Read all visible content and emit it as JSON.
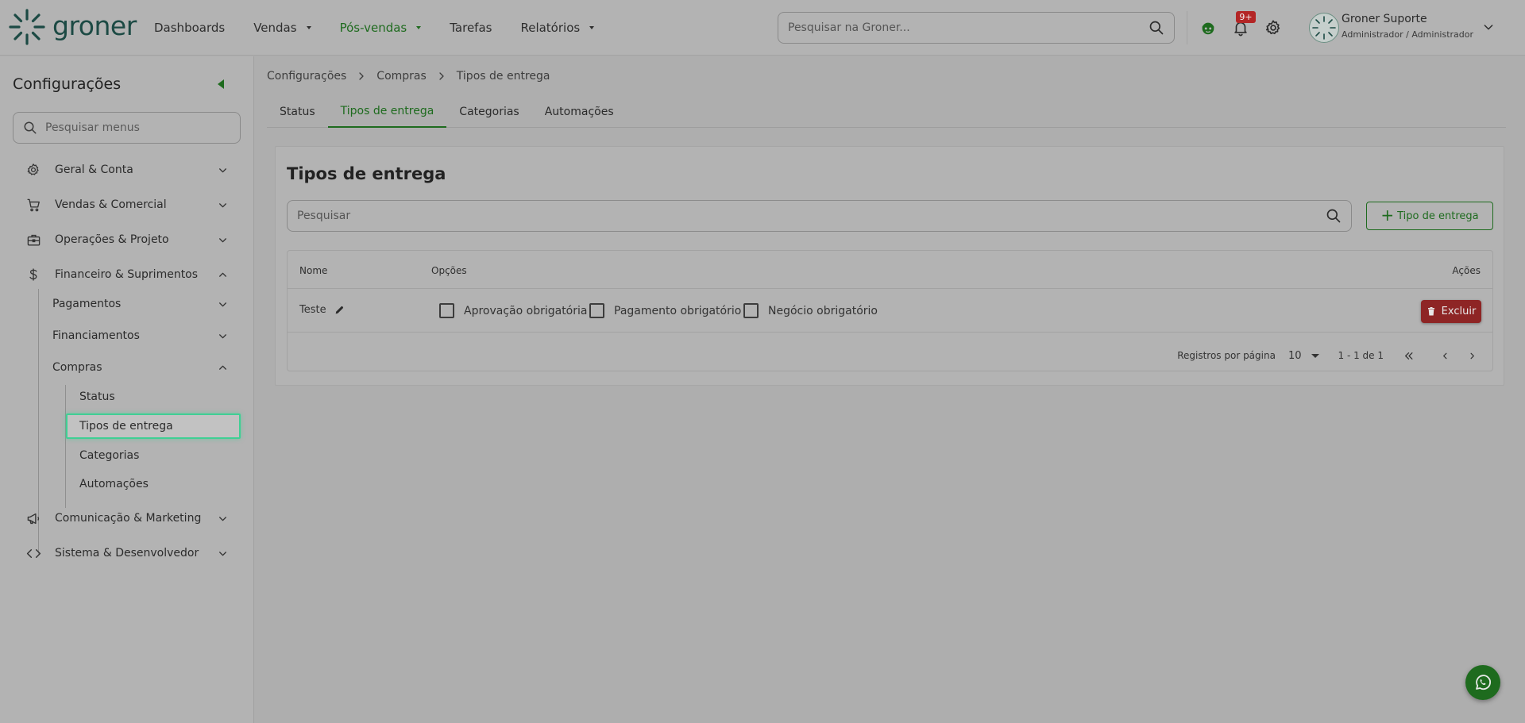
{
  "header": {
    "logo_text": "groner",
    "nav": [
      {
        "label": "Dashboards",
        "has_caret": false,
        "active": false
      },
      {
        "label": "Vendas",
        "has_caret": true,
        "active": false
      },
      {
        "label": "Pós-vendas",
        "has_caret": true,
        "active": true
      },
      {
        "label": "Tarefas",
        "has_caret": false,
        "active": false
      },
      {
        "label": "Relatórios",
        "has_caret": true,
        "active": false
      }
    ],
    "search_placeholder": "Pesquisar na Groner...",
    "notifications_badge": "9+",
    "user_name": "Groner Suporte",
    "user_role": "Administrador / Administrador"
  },
  "sidebar": {
    "title": "Configurações",
    "search_placeholder": "Pesquisar menus",
    "sections": [
      {
        "label": "Geral & Conta",
        "icon": "gear-icon",
        "expanded": false
      },
      {
        "label": "Vendas & Comercial",
        "icon": "cart-icon",
        "expanded": false
      },
      {
        "label": "Operações & Projeto",
        "icon": "briefcase-icon",
        "expanded": false
      },
      {
        "label": "Financeiro & Suprimentos",
        "icon": "dollar-icon",
        "expanded": true
      },
      {
        "label": "Comunicação & Marketing",
        "icon": "megaphone-icon",
        "expanded": false
      },
      {
        "label": "Sistema & Desenvolvedor",
        "icon": "code-icon",
        "expanded": false
      }
    ],
    "finance_children": [
      {
        "label": "Pagamentos",
        "expanded": false
      },
      {
        "label": "Financiamentos",
        "expanded": false
      },
      {
        "label": "Compras",
        "expanded": true
      }
    ],
    "compras_children": [
      {
        "label": "Status",
        "selected": false
      },
      {
        "label": "Tipos de entrega",
        "selected": true
      },
      {
        "label": "Categorias",
        "selected": false
      },
      {
        "label": "Automações",
        "selected": false
      }
    ]
  },
  "breadcrumb": [
    "Configurações",
    "Compras",
    "Tipos de entrega"
  ],
  "tabs": [
    {
      "label": "Status",
      "active": false
    },
    {
      "label": "Tipos de entrega",
      "active": true
    },
    {
      "label": "Categorias",
      "active": false
    },
    {
      "label": "Automações",
      "active": false
    }
  ],
  "card": {
    "title": "Tipos de entrega",
    "search_placeholder": "Pesquisar",
    "add_button_label": "Tipo de entrega",
    "columns": {
      "name": "Nome",
      "options": "Opções",
      "actions": "Ações"
    },
    "rows": [
      {
        "name": "Teste",
        "options": [
          {
            "label": "Aprovação obrigatória",
            "checked": false
          },
          {
            "label": "Pagamento obrigatório",
            "checked": false
          },
          {
            "label": "Negócio obrigatório",
            "checked": false
          }
        ],
        "delete_label": "Excluir"
      }
    ],
    "pagination": {
      "per_page_label": "Registros por página",
      "per_page_value": "10",
      "range_label": "1 - 1 de 1"
    }
  },
  "colors": {
    "accent_green": "#1e6b1e",
    "danger_red": "#8e2525",
    "selection_outline": "#3fcf94",
    "badge_red": "#b32525"
  }
}
